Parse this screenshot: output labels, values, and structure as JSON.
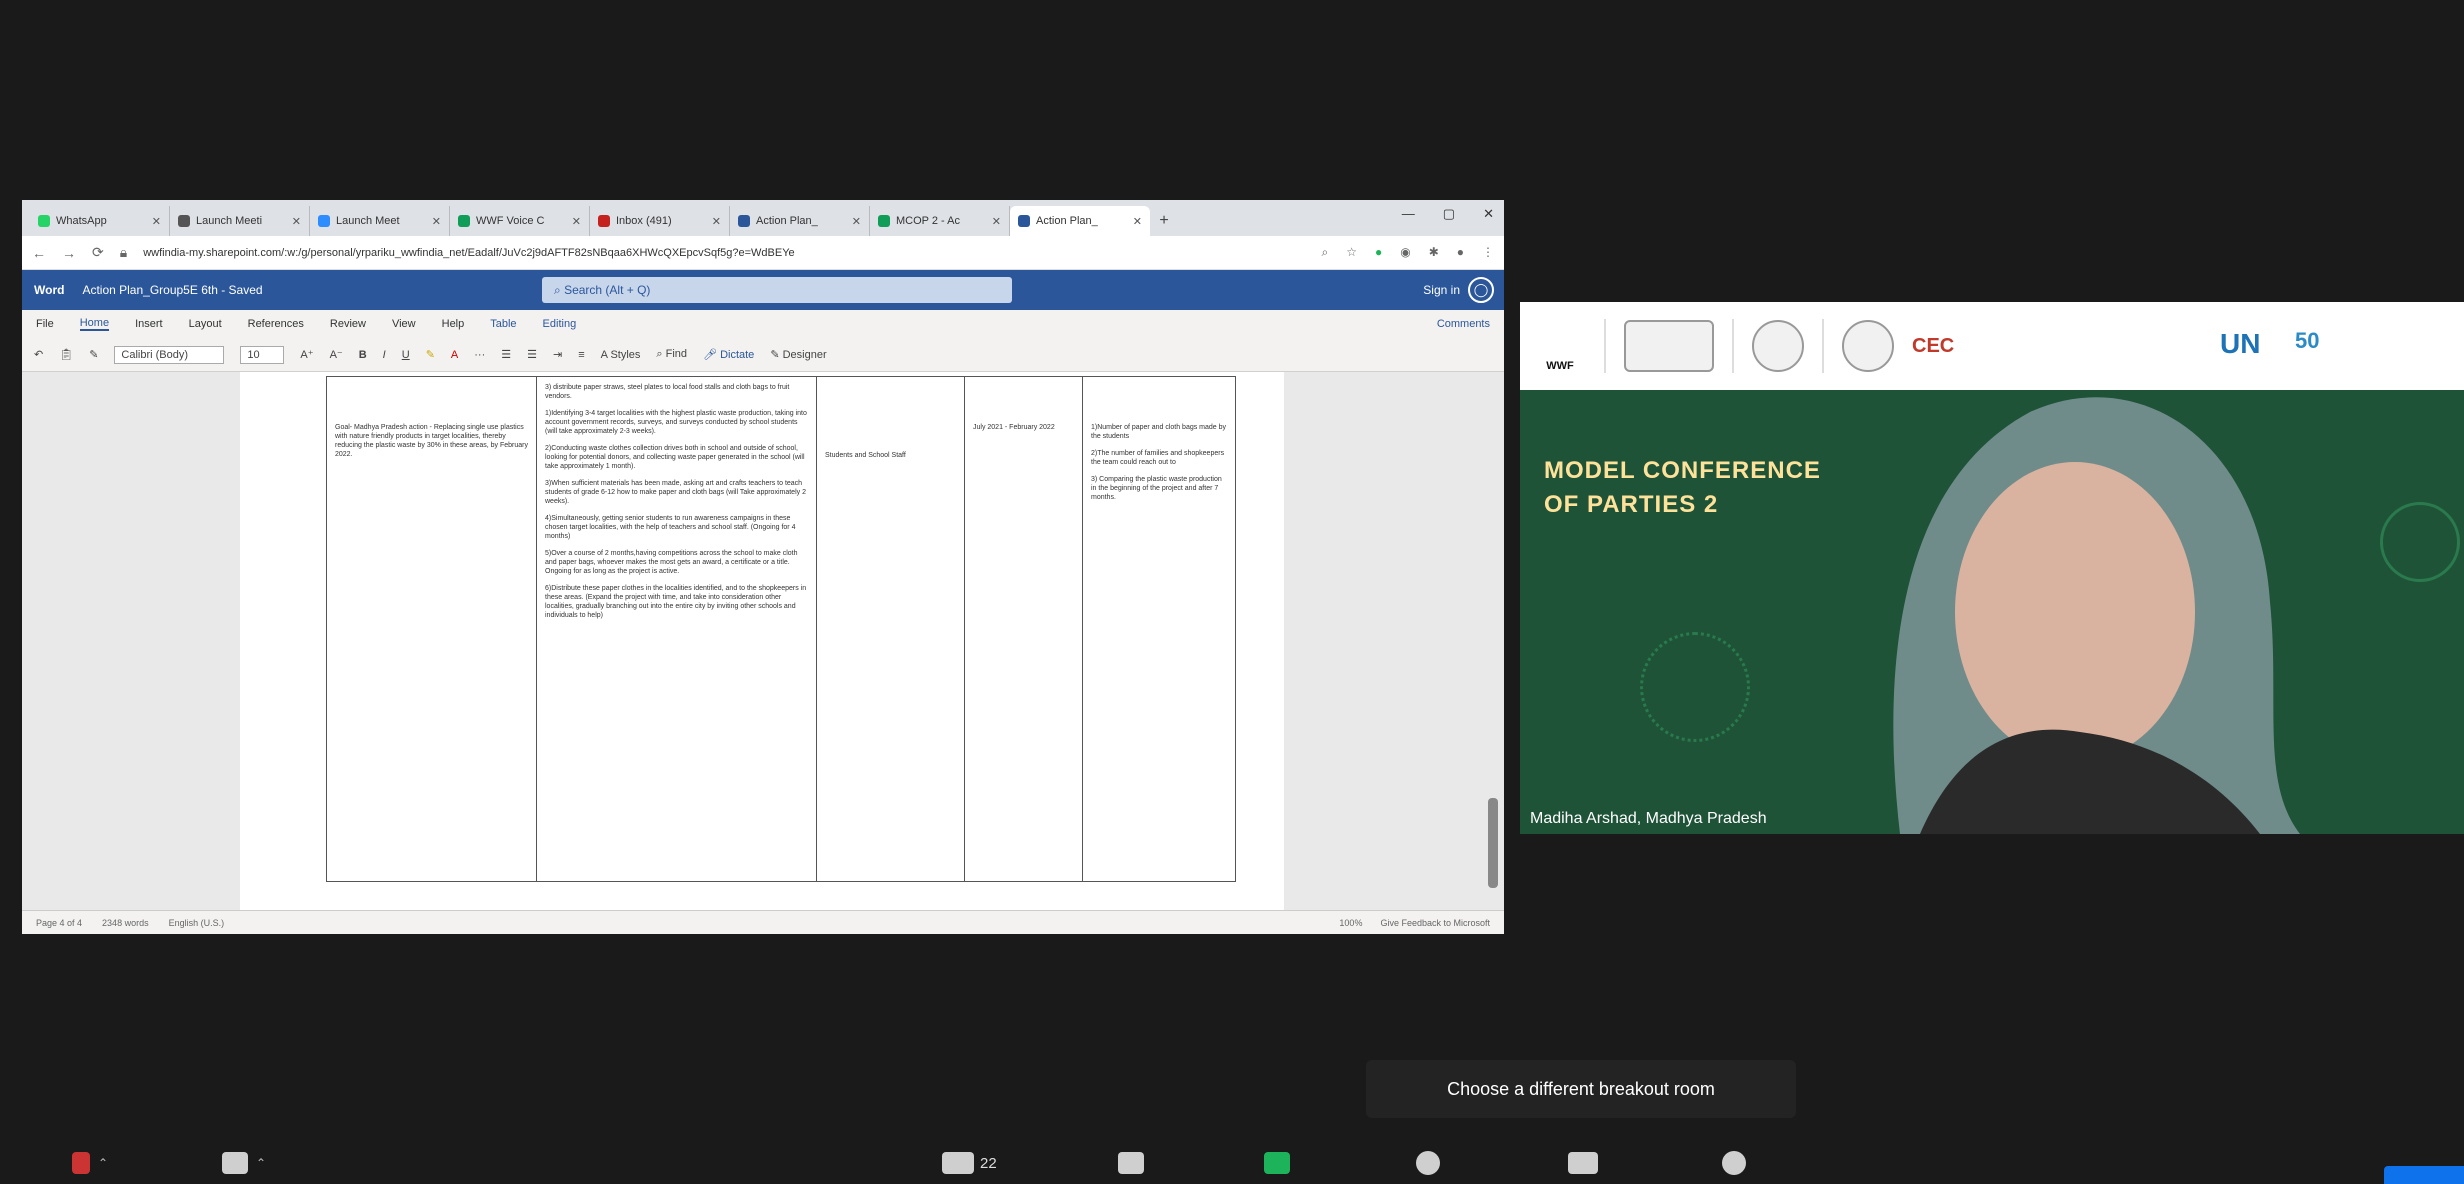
{
  "browser": {
    "tabs": [
      {
        "label": "WhatsApp",
        "color": "#25d366"
      },
      {
        "label": "Launch Meeti",
        "color": "#555555"
      },
      {
        "label": "Launch Meet",
        "color": "#2d8cff"
      },
      {
        "label": "WWF Voice C",
        "color": "#0f9d58"
      },
      {
        "label": "Inbox (491)",
        "color": "#c5221f"
      },
      {
        "label": "Action Plan_",
        "color": "#2b579a"
      },
      {
        "label": "MCOP 2 - Ac",
        "color": "#0f9d58"
      },
      {
        "label": "Action Plan_",
        "color": "#2b579a",
        "active": true
      }
    ],
    "url": "wwfindia-my.sharepoint.com/:w:/g/personal/yrpariku_wwfindia_net/Eadalf/JuVc2j9dAFTF82sNBqaa6XHWcQXEpcvSqf5g?e=WdBEYe"
  },
  "word": {
    "app_name": "Word",
    "doc_title": "Action Plan_Group5E 6th - Saved",
    "search_placeholder": "Search (Alt + Q)",
    "signin": "Sign in",
    "menu": [
      "File",
      "Home",
      "Insert",
      "Layout",
      "References",
      "Review",
      "View",
      "Help",
      "Table",
      "Editing"
    ],
    "comments": "Comments",
    "font": "Calibri (Body)",
    "size": "10",
    "ribbon_labels": [
      "Styles",
      "Find",
      "Dictate",
      "Designer"
    ],
    "table": {
      "col1": "Goal- Madhya Pradesh action - Replacing single use plastics with nature friendly products in target localities, thereby reducing the plastic waste by 30% in these areas, by February 2022.",
      "col2": [
        "3) distribute paper straws, steel plates to local food stalls and cloth bags to fruit vendors.",
        "1)Identifying 3-4 target localities with the highest plastic waste production, taking into account government records, surveys, and surveys conducted by school students (will take approximately 2-3 weeks).",
        "2)Conducting waste clothes collection drives both in school and outside of school, looking for potential donors, and collecting waste paper generated in the school (will take approximately 1 month).",
        "3)When sufficient materials has been made, asking art and crafts teachers to teach students of grade 6-12 how to make paper and cloth bags (will Take approximately 2 weeks).",
        "4)Simultaneously, getting senior students to run awareness campaigns in these chosen target localities, with the help of teachers and school staff. (Ongoing for 4 months)",
        "5)Over a course of 2 months,having competitions across the school to make cloth and paper bags, whoever makes the most gets an award, a certificate or a title. Ongoing for as long as the project is active.",
        "6)Distribute these paper clothes in the localities identified, and to the shopkeepers in these areas. (Expand the project with time, and take into consideration other localities, gradually branching out into the entire city by inviting other schools and individuals to help)"
      ],
      "col3": "Students and School Staff",
      "col4": "July 2021 - February 2022",
      "col5": [
        "1)Number of paper and cloth bags made by the students",
        "2)The number of families and shopkeepers the team could reach out to",
        "3) Comparing the plastic waste production in the beginning of the project and after 7 months."
      ]
    },
    "status_left": [
      "Page 4 of 4",
      "2348 words",
      "English (U.S.)"
    ],
    "status_right": [
      "100%",
      "Give Feedback to Microsoft"
    ]
  },
  "video": {
    "title_line1": "MODEL CONFERENCE",
    "title_line2": "OF PARTIES 2",
    "logo_wwf": "WWF",
    "logo_text": "CEC",
    "logo_un": "UN",
    "logo_50": "50",
    "participant": "Madiha Arshad, Madhya Pradesh"
  },
  "tooltip": "Choose a different breakout room",
  "toolbar": {
    "participants_count": "22"
  },
  "colors": {
    "zoom_bg": "#1a1a1a",
    "word_blue": "#2b579a",
    "video_green": "#1e5338",
    "title_yellow": "#ffe29a",
    "share_green": "#1db35a"
  }
}
